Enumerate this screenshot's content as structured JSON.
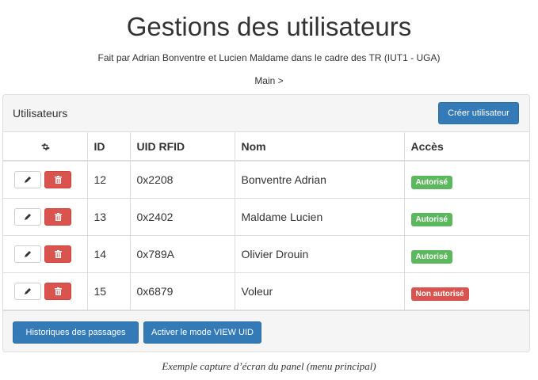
{
  "header": {
    "title": "Gestions des utilisateurs",
    "subtitle": "Fait par Adrian Bonventre et Lucien Maldame dans le cadre des TR (IUT1 - UGA)",
    "breadcrumb": "Main >"
  },
  "panel": {
    "title": "Utilisateurs",
    "create_button": "Créer utilisateur"
  },
  "table": {
    "columns": {
      "actions_icon": "gear-icon",
      "id": "ID",
      "uid": "UID RFID",
      "nom": "Nom",
      "acces": "Accès"
    },
    "rows": [
      {
        "id": "12",
        "uid": "0x2208",
        "nom": "Bonventre Adrian",
        "acces": "Autorisé",
        "acces_color": "#5cb85c"
      },
      {
        "id": "13",
        "uid": "0x2402",
        "nom": "Maldame Lucien",
        "acces": "Autorisé",
        "acces_color": "#5cb85c"
      },
      {
        "id": "14",
        "uid": "0x789A",
        "nom": "Olivier Drouin",
        "acces": "Autorisé",
        "acces_color": "#5cb85c"
      },
      {
        "id": "15",
        "uid": "0x6879",
        "nom": "Voleur",
        "acces": "Non autorisé",
        "acces_color": "#d9534f"
      }
    ],
    "row_actions": {
      "edit_icon": "pencil-icon",
      "delete_icon": "trash-icon"
    }
  },
  "footer": {
    "history_button": "Historiques des passages",
    "viewuid_button": "Activer le mode VIEW UID"
  },
  "caption": "Exemple capture d’écran du panel (menu principal)",
  "colors": {
    "primary": "#337ab7",
    "success": "#5cb85c",
    "danger": "#d9534f",
    "panel_bg": "#f5f5f5"
  }
}
